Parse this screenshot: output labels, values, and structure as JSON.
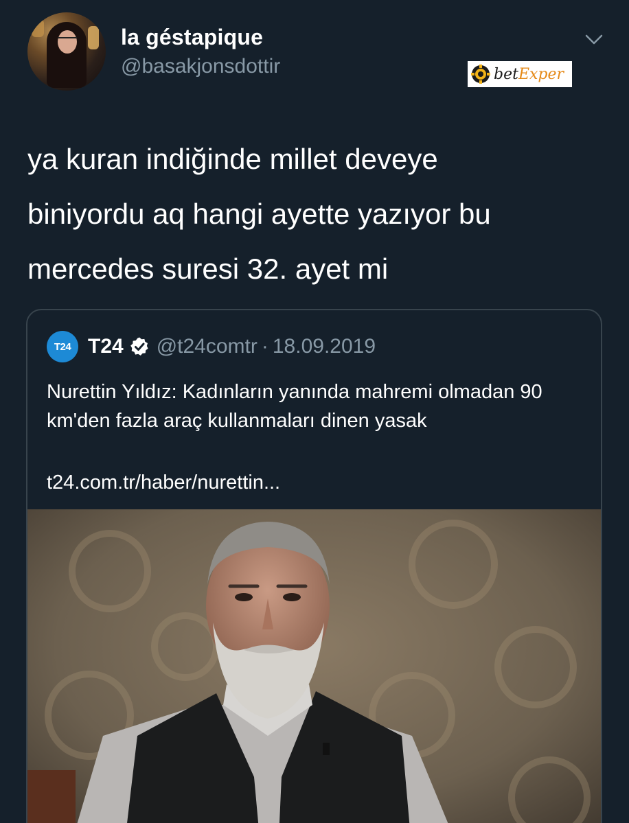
{
  "author": {
    "display_name": "la géstapique",
    "handle": "@basakjonsdottir",
    "avatar_icon": "profile-photo"
  },
  "watermark": {
    "text_main": "bet",
    "text_accent": "Exper"
  },
  "tweet": {
    "text": "ya kuran indiğinde millet deveye\nbiniyordu aq hangi ayette yazıyor bu\nmercedes suresi 32. ayet mi"
  },
  "quoted_tweet": {
    "avatar_text": "T24",
    "name": "T24",
    "handle": "@t24comtr",
    "separator": "·",
    "date": "18.09.2019",
    "text": "Nurettin Yıldız: Kadınların yanında mahremi olmadan 90 km'den fazla araç kullanmaları dinen yasak",
    "link": "t24.com.tr/haber/nurettin...",
    "image_icon": "news-photo"
  },
  "colors": {
    "background": "#15202b",
    "secondary_text": "#8899a6",
    "border": "#38444d",
    "t24_blue": "#1d8ad6"
  }
}
